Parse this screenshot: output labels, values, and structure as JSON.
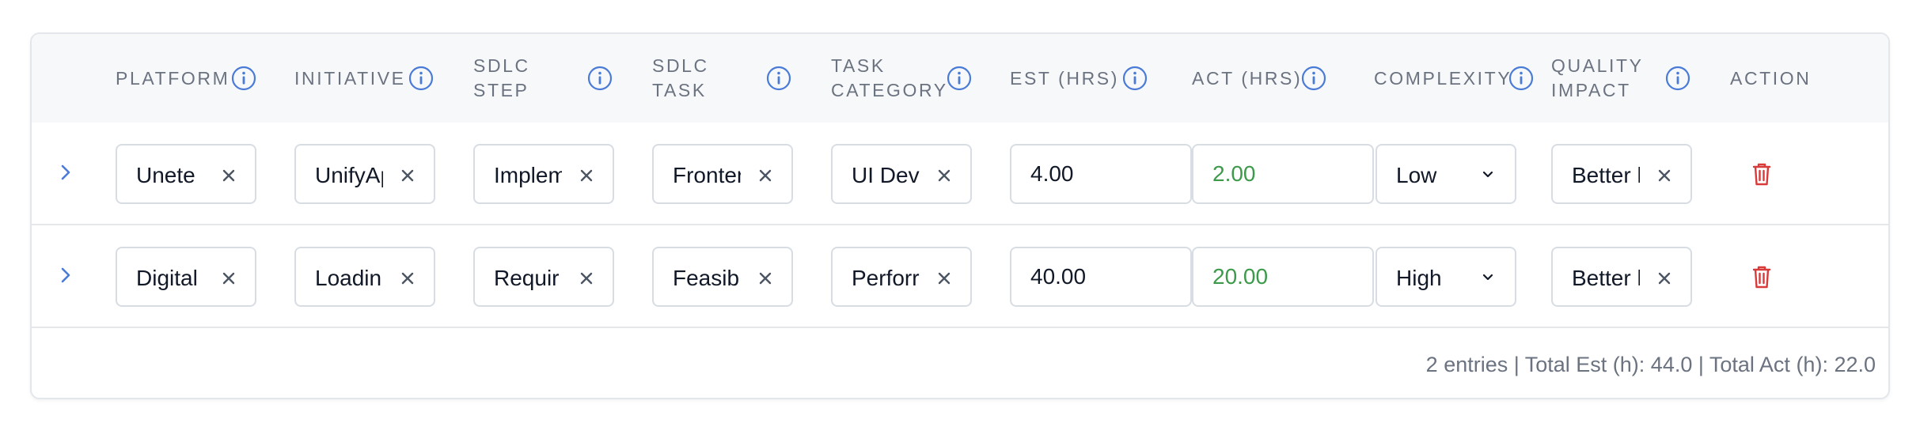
{
  "table": {
    "columns": [
      {
        "key": "platform",
        "label": "PLATFORM",
        "info": true
      },
      {
        "key": "initiative",
        "label": "INITIATIVE",
        "info": true
      },
      {
        "key": "sdlc_step",
        "label": "SDLC\nSTEP",
        "info": true
      },
      {
        "key": "sdlc_task",
        "label": "SDLC\nTASK",
        "info": true
      },
      {
        "key": "task_category",
        "label": "TASK\nCATEGORY",
        "info": true
      },
      {
        "key": "est",
        "label": "EST (HRS)",
        "info": true
      },
      {
        "key": "act",
        "label": "ACT (HRS)",
        "info": true
      },
      {
        "key": "complexity",
        "label": "COMPLEXITY",
        "info": true
      },
      {
        "key": "quality_impact",
        "label": "QUALITY\nIMPACT",
        "info": true
      },
      {
        "key": "action",
        "label": "ACTION",
        "info": false
      }
    ],
    "rows": [
      {
        "platform": "Unete",
        "initiative": "UnifyAp",
        "sdlc_step": "Implem",
        "sdlc_task": "Fronter",
        "task_category": "UI Dev",
        "est": "4.00",
        "act": "2.00",
        "complexity": "Low",
        "quality_impact": "Better l"
      },
      {
        "platform": "Digital",
        "initiative": "Loadin",
        "sdlc_step": "Requir",
        "sdlc_task": "Feasib",
        "task_category": "Perforr",
        "est": "40.00",
        "act": "20.00",
        "complexity": "High",
        "quality_impact": "Better l"
      }
    ],
    "footer": "2 entries | Total Est (h): 44.0 | Total Act (h): 22.0"
  },
  "icons": {
    "info": "info-circle-icon",
    "expand": "chevron-right-icon",
    "remove": "close-icon",
    "dropdown": "chevron-down-icon",
    "delete": "trash-icon"
  },
  "colors": {
    "accent": "#4a7bd6",
    "act_value": "#3d9a4b",
    "delete": "#d93a3a",
    "header_bg": "#f7f8fa"
  }
}
